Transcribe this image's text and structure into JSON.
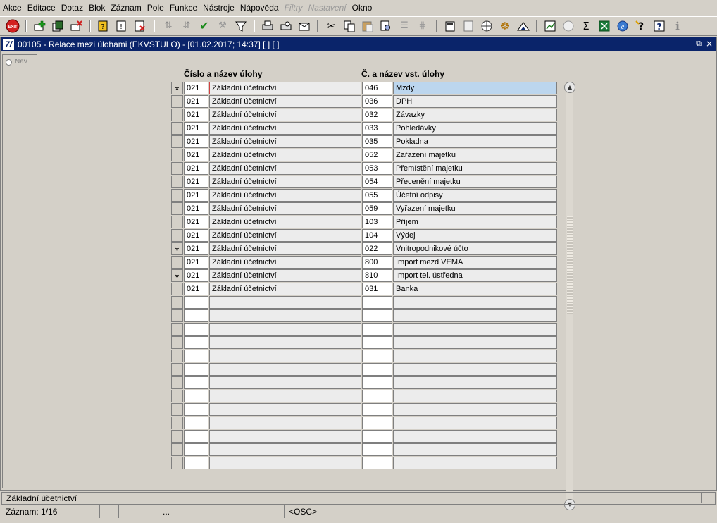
{
  "menu": [
    "Akce",
    "Editace",
    "Dotaz",
    "Blok",
    "Záznam",
    "Pole",
    "Funkce",
    "Nástroje",
    "Nápověda",
    "Filtry",
    "Nastavení",
    "Okno"
  ],
  "menu_disabled": [
    "Filtry",
    "Nastavení"
  ],
  "toolbar": {
    "exit_label": "EXIT",
    "icons": [
      "exit-icon",
      "insert-record-icon",
      "duplicate-record-icon",
      "delete-record-icon",
      "enter-query-icon",
      "execute-query-icon",
      "cancel-query-icon",
      "sort-asc-icon",
      "sort-desc-icon",
      "commit-icon",
      "tools-icon",
      "filter-icon",
      "print-icon",
      "print-preview-icon",
      "mail-icon",
      "cut-icon",
      "copy-icon",
      "paste-icon",
      "find-icon",
      "list-icon",
      "tree-icon",
      "calculator-icon",
      "document-icon",
      "globe-icon",
      "helm-icon",
      "triangle-icon",
      "chart-icon",
      "calendar-icon",
      "sum-icon",
      "excel-icon",
      "internet-explorer-icon",
      "help-context-icon",
      "help-icon",
      "info-icon"
    ]
  },
  "window": {
    "logo": "7/",
    "title": "00105 - Relace mezi úlohami (EKVSTULO) - [01.02.2017; 14:37]  [ ]  [ ]",
    "restore_symbol": "⧉",
    "close_symbol": "×"
  },
  "nav": {
    "label": "Nav"
  },
  "headers": {
    "task": "Číslo a název úlohy",
    "input_task": "Č. a název vst. úlohy"
  },
  "rows": [
    {
      "mark": "*",
      "num": "021",
      "name": "Základní účetnictví",
      "vnum": "046",
      "vname": "Mzdy"
    },
    {
      "mark": "",
      "num": "021",
      "name": "Základní účetnictví",
      "vnum": "036",
      "vname": "DPH"
    },
    {
      "mark": "",
      "num": "021",
      "name": "Základní účetnictví",
      "vnum": "032",
      "vname": "Závazky"
    },
    {
      "mark": "",
      "num": "021",
      "name": "Základní účetnictví",
      "vnum": "033",
      "vname": "Pohledávky"
    },
    {
      "mark": "",
      "num": "021",
      "name": "Základní účetnictví",
      "vnum": "035",
      "vname": "Pokladna"
    },
    {
      "mark": "",
      "num": "021",
      "name": "Základní účetnictví",
      "vnum": "052",
      "vname": "Zařazení majetku"
    },
    {
      "mark": "",
      "num": "021",
      "name": "Základní účetnictví",
      "vnum": "053",
      "vname": "Přemístění majetku"
    },
    {
      "mark": "",
      "num": "021",
      "name": "Základní účetnictví",
      "vnum": "054",
      "vname": "Přecenění majetku"
    },
    {
      "mark": "",
      "num": "021",
      "name": "Základní účetnictví",
      "vnum": "055",
      "vname": "Účetní odpisy"
    },
    {
      "mark": "",
      "num": "021",
      "name": "Základní účetnictví",
      "vnum": "059",
      "vname": "Vyřazení majetku"
    },
    {
      "mark": "",
      "num": "021",
      "name": "Základní účetnictví",
      "vnum": "103",
      "vname": "Příjem"
    },
    {
      "mark": "",
      "num": "021",
      "name": "Základní účetnictví",
      "vnum": "104",
      "vname": "Výdej"
    },
    {
      "mark": "*",
      "num": "021",
      "name": "Základní účetnictví",
      "vnum": "022",
      "vname": "Vnitropodnikové účto"
    },
    {
      "mark": "",
      "num": "021",
      "name": "Základní účetnictví",
      "vnum": "800",
      "vname": "Import mezd VEMA"
    },
    {
      "mark": "*",
      "num": "021",
      "name": "Základní účetnictví",
      "vnum": "810",
      "vname": "Import tel. ústředna"
    },
    {
      "mark": "",
      "num": "021",
      "name": "Základní účetnictví",
      "vnum": "031",
      "vname": "Banka"
    }
  ],
  "scrollbar": {
    "up_symbol": "▲",
    "down_symbol": "▼"
  },
  "status": {
    "message": "Základní účetnictví",
    "record": "Záznam: 1/16",
    "ellipsis": "...",
    "mode": "<OSC>"
  }
}
